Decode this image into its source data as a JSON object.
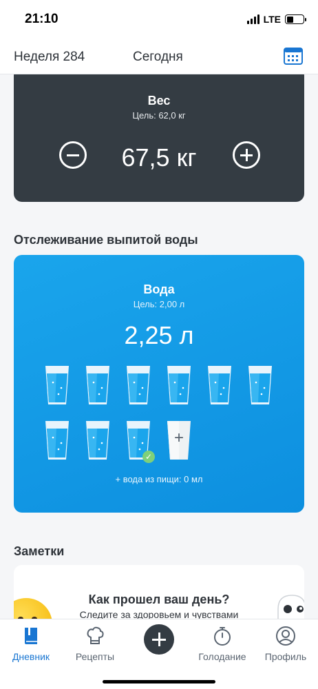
{
  "status_bar": {
    "time": "21:10",
    "network": "LTE",
    "battery_level": 0.4
  },
  "top_nav": {
    "week": "Неделя 284",
    "today": "Сегодня",
    "calendar_icon": "calendar-icon"
  },
  "weight": {
    "title": "Вес",
    "goal": "Цель: 62,0 кг",
    "value": "67,5 кг"
  },
  "water_section": {
    "title": "Отслеживание выпитой воды"
  },
  "water": {
    "title": "Вода",
    "goal": "Цель: 2,00 л",
    "value": "2,25 л",
    "glasses_filled": 9,
    "checked_glass": 8,
    "food_water": "+ вода из пищи: 0 мл",
    "add_glass_label": "+",
    "check_mark": "✓"
  },
  "notes_section": {
    "title": "Заметки"
  },
  "notes": {
    "title": "Как прошел ваш день?",
    "subtitle": "Следите за здоровьем и чувствами"
  },
  "tab_bar": {
    "diary": "Дневник",
    "recipes": "Рецепты",
    "fasting": "Голодание",
    "profile": "Профиль",
    "active": "diary"
  },
  "colors": {
    "accent": "#1976d2",
    "water": "#1aa5ec",
    "dark_card": "#343c43",
    "check": "#7ed07a"
  }
}
